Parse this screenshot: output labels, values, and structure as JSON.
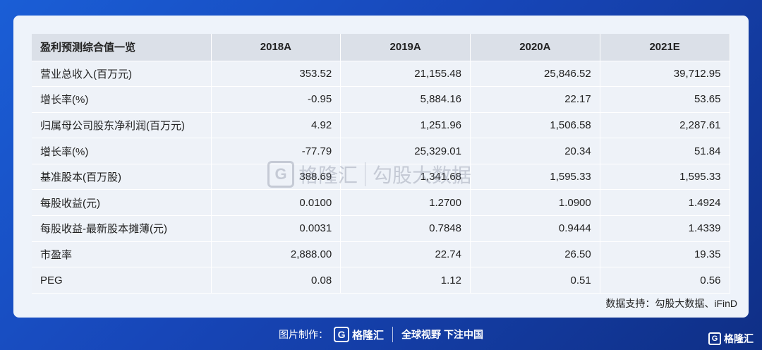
{
  "table": {
    "headers": [
      "盈利预测综合值一览",
      "2018A",
      "2019A",
      "2020A",
      "2021E"
    ],
    "rows": [
      {
        "label": "营业总收入(百万元)",
        "values": [
          "353.52",
          "21,155.48",
          "25,846.52",
          "39,712.95"
        ]
      },
      {
        "label": "增长率(%)",
        "values": [
          "-0.95",
          "5,884.16",
          "22.17",
          "53.65"
        ]
      },
      {
        "label": "归属母公司股东净利润(百万元)",
        "values": [
          "4.92",
          "1,251.96",
          "1,506.58",
          "2,287.61"
        ]
      },
      {
        "label": "增长率(%)",
        "values": [
          "-77.79",
          "25,329.01",
          "20.34",
          "51.84"
        ]
      },
      {
        "label": "基准股本(百万股)",
        "values": [
          "388.69",
          "1,341.68",
          "1,595.33",
          "1,595.33"
        ]
      },
      {
        "label": "每股收益(元)",
        "values": [
          "0.0100",
          "1.2700",
          "1.0900",
          "1.4924"
        ]
      },
      {
        "label": "每股收益-最新股本摊薄(元)",
        "values": [
          "0.0031",
          "0.7848",
          "0.9444",
          "1.4339"
        ]
      },
      {
        "label": "市盈率",
        "values": [
          "2,888.00",
          "22.74",
          "26.50",
          "19.35"
        ]
      },
      {
        "label": "PEG",
        "values": [
          "0.08",
          "1.12",
          "0.51",
          "0.56"
        ]
      }
    ]
  },
  "source": "数据支持：勾股大数据、iFinD",
  "watermark": {
    "logo_letter": "G",
    "brand": "格隆汇",
    "text": "勾股大数据"
  },
  "footer": {
    "prefix": "图片制作：",
    "logo_letter": "G",
    "brand": "格隆汇",
    "slogan": "全球视野 下注中国"
  },
  "corner": {
    "logo_letter": "G",
    "brand": "格隆汇"
  },
  "colors": {
    "background": "#1746b8",
    "header_bg": "#dbe0e8",
    "row_bg": "#eef2f8"
  },
  "icons": [
    "gelonghui-logo-icon"
  ]
}
